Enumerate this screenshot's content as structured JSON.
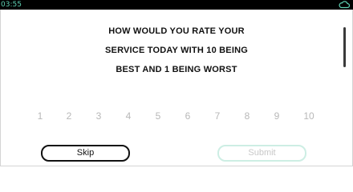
{
  "status_bar": {
    "time": "03:55",
    "time_color": "#5fd3b5",
    "icon": "cloud-icon"
  },
  "question": {
    "line1": "HOW WOULD YOU RATE YOUR",
    "line2": "SERVICE TODAY WITH 10 BEING",
    "line3": "BEST AND 1 BEING WORST"
  },
  "rating": {
    "options": [
      "1",
      "2",
      "3",
      "4",
      "5",
      "6",
      "7",
      "8",
      "9",
      "10"
    ],
    "option_color": "#b8b8b8"
  },
  "actions": {
    "skip_label": "Skip",
    "submit_label": "Submit",
    "submit_border_color": "#cdeee4"
  }
}
